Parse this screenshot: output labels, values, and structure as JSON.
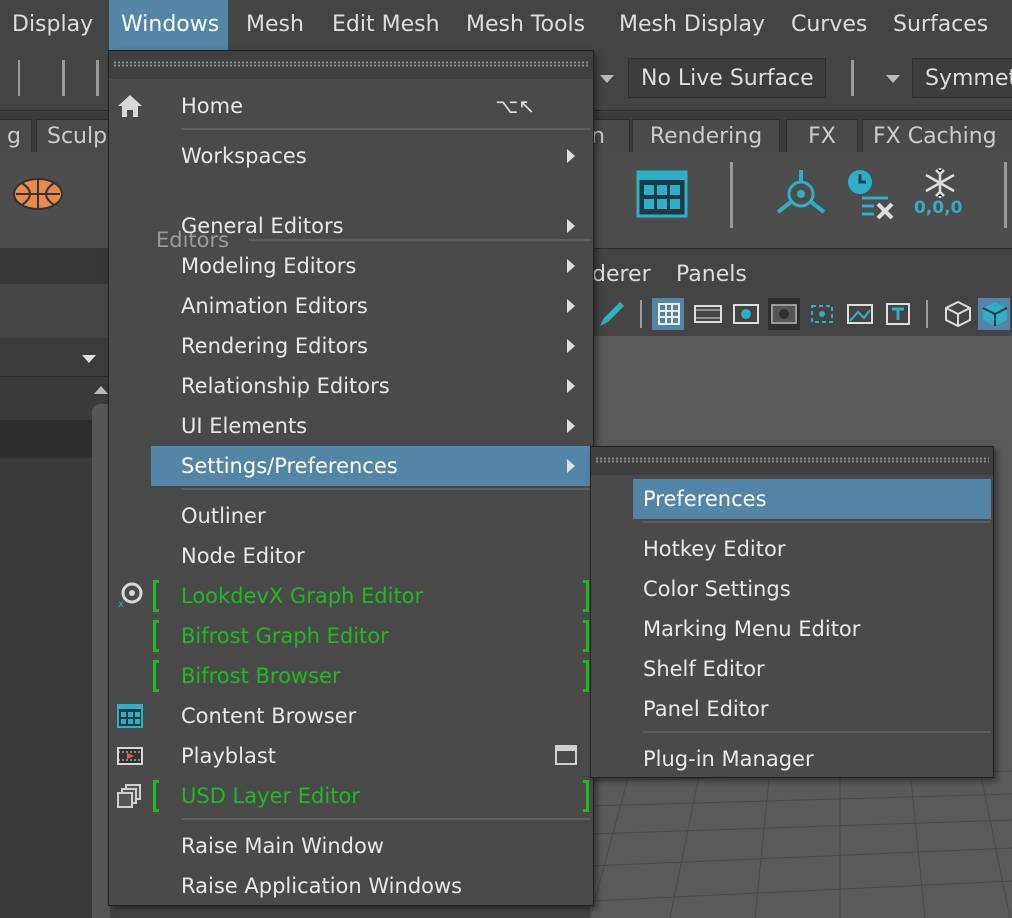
{
  "menubar": {
    "items": [
      "Display",
      "Windows",
      "Mesh",
      "Edit Mesh",
      "Mesh Tools",
      "Mesh Display",
      "Curves",
      "Surfaces"
    ],
    "active": "Windows"
  },
  "statusline": {
    "live_surface": "No Live Surface",
    "symmetry": "Symmetr"
  },
  "shelf_tabs": [
    "g",
    "Sculp",
    "n",
    "Rendering",
    "FX",
    "FX Caching"
  ],
  "viewport_menus": [
    "derer",
    "Panels"
  ],
  "shelf_icon_label": "0,0,0",
  "windows_menu": {
    "home": {
      "label": "Home",
      "hotkey": "⌥↖"
    },
    "workspaces": "Workspaces",
    "editors_section": "Editors",
    "editor_items": [
      "General Editors",
      "Modeling Editors",
      "Animation Editors",
      "Rendering Editors",
      "Relationship Editors",
      "UI Elements",
      "Settings/Preferences"
    ],
    "outliner": "Outliner",
    "node_editor": "Node Editor",
    "lookdevx": "LookdevX Graph Editor",
    "bifrost_graph": "Bifrost Graph Editor",
    "bifrost_browser": "Bifrost Browser",
    "content_browser": "Content Browser",
    "playblast": "Playblast",
    "usd_layer": "USD Layer Editor",
    "raise_main": "Raise Main Window",
    "raise_app": "Raise Application Windows"
  },
  "settings_submenu": {
    "items_top": [
      "Preferences"
    ],
    "items_mid": [
      "Hotkey Editor",
      "Color Settings",
      "Marking Menu Editor",
      "Shelf Editor",
      "Panel Editor"
    ],
    "items_bottom": [
      "Plug-in Manager"
    ]
  },
  "colors": {
    "highlight": "#5285a6",
    "plugin_green": "#1dbb1d",
    "menu_bg": "#4a4a4a"
  }
}
